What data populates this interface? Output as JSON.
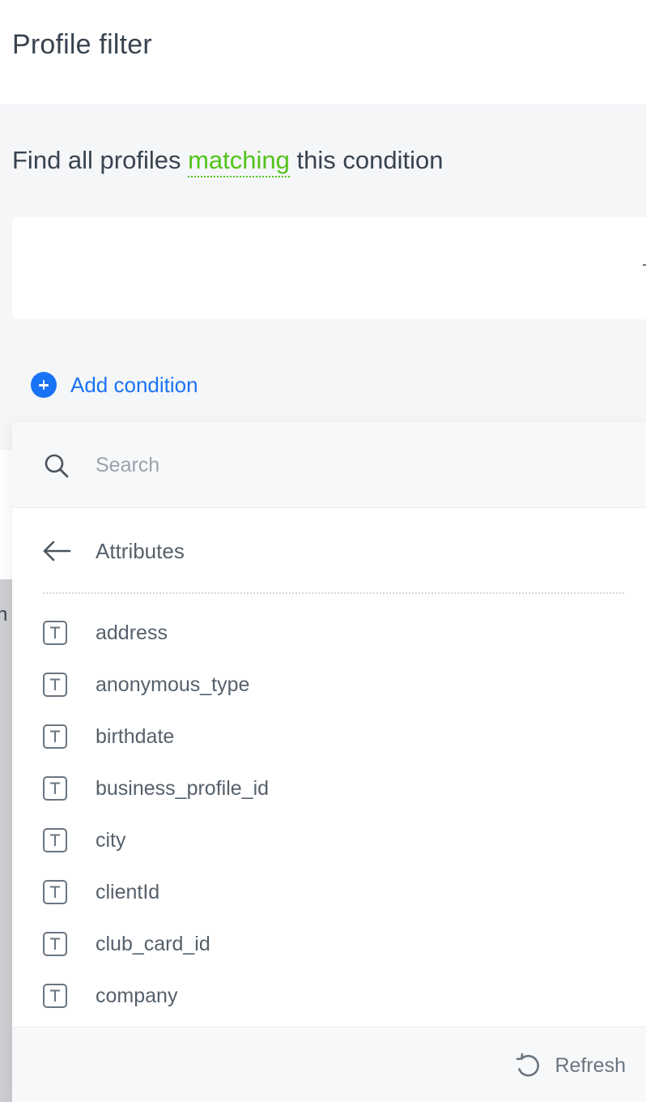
{
  "header": {
    "title": "Profile filter"
  },
  "condition": {
    "prefix": "Find all profiles ",
    "match_mode": "matching",
    "suffix": " this condition"
  },
  "add_condition": {
    "label": "Add condition"
  },
  "dropdown": {
    "search": {
      "placeholder": "Search",
      "value": ""
    },
    "back_label": "Attributes",
    "items": [
      {
        "label": "address",
        "icon": "text-type-icon"
      },
      {
        "label": "anonymous_type",
        "icon": "text-type-icon"
      },
      {
        "label": "birthdate",
        "icon": "text-type-icon"
      },
      {
        "label": "business_profile_id",
        "icon": "text-type-icon"
      },
      {
        "label": "city",
        "icon": "text-type-icon"
      },
      {
        "label": "clientId",
        "icon": "text-type-icon"
      },
      {
        "label": "club_card_id",
        "icon": "text-type-icon"
      },
      {
        "label": "company",
        "icon": "text-type-icon"
      }
    ],
    "refresh_label": "Refresh"
  },
  "background": {
    "partial_letter": "n"
  },
  "colors": {
    "accent_blue": "#1a73f5",
    "match_green": "#52c41a",
    "text_dark": "#384350",
    "text_muted": "#55606b",
    "page_bg": "#f5f6f8"
  }
}
